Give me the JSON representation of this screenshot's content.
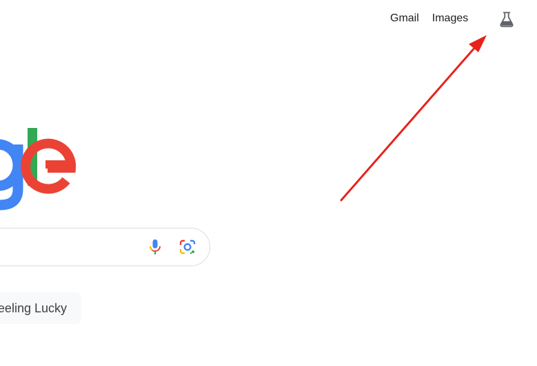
{
  "header": {
    "links": [
      {
        "label": "Gmail"
      },
      {
        "label": "Images"
      }
    ],
    "labs_icon": "flask-icon"
  },
  "logo": {
    "letters": [
      "g",
      "l",
      "e"
    ],
    "colors": {
      "blue": "#4285f4",
      "green": "#34a853",
      "red": "#ea4335"
    }
  },
  "search": {
    "mic_icon": "microphone-icon",
    "lens_icon": "camera-lens-icon"
  },
  "buttons": {
    "lucky_label": "eeling Lucky"
  },
  "annotation": {
    "arrow_color": "#e8221b"
  }
}
